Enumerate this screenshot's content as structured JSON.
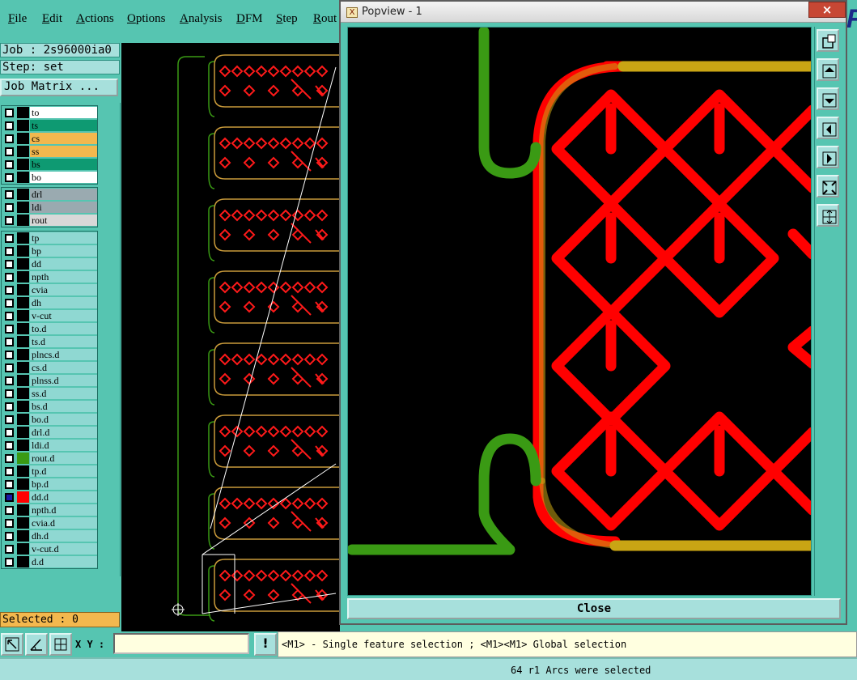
{
  "menubar": {
    "items": [
      {
        "label": "File",
        "mnemonic": "F",
        "rest": "ile"
      },
      {
        "label": "Edit",
        "mnemonic": "E",
        "rest": "dit"
      },
      {
        "label": "Actions",
        "mnemonic": "A",
        "rest": "ctions"
      },
      {
        "label": "Options",
        "mnemonic": "O",
        "rest": "ptions"
      },
      {
        "label": "Analysis",
        "mnemonic": "A",
        "rest": "nalysis"
      },
      {
        "label": "DFM",
        "mnemonic": "D",
        "rest": "FM"
      },
      {
        "label": "Step",
        "mnemonic": "S",
        "rest": "tep"
      },
      {
        "label": "Rout",
        "mnemonic": "R",
        "rest": "out"
      }
    ],
    "corner_text": "F"
  },
  "left_panel": {
    "job_label": "Job : 2s96000ia0",
    "step_label": "Step: set",
    "job_matrix_button": "Job Matrix ...",
    "selected_label": "Selected : 0",
    "layer_groups": [
      [
        {
          "name": "to",
          "color": "#ffffff",
          "swatch": "#000000",
          "selected": false
        },
        {
          "name": "ts",
          "color": "#0e9a72",
          "swatch": "#000000",
          "selected": false
        },
        {
          "name": "cs",
          "color": "#f3b84e",
          "swatch": "#000000",
          "selected": false
        },
        {
          "name": "ss",
          "color": "#f3b84e",
          "swatch": "#000000",
          "selected": false
        },
        {
          "name": "bs",
          "color": "#0e9a72",
          "swatch": "#000000",
          "selected": false
        },
        {
          "name": "bo",
          "color": "#ffffff",
          "swatch": "#000000",
          "selected": false
        }
      ],
      [
        {
          "name": "drl",
          "color": "#9aaab0",
          "swatch": "#000000",
          "selected": false
        },
        {
          "name": "ldi",
          "color": "#9aaab0",
          "swatch": "#000000",
          "selected": false
        },
        {
          "name": "rout",
          "color": "#d8d8d8",
          "swatch": "#000000",
          "selected": false
        }
      ],
      [
        {
          "name": "tp",
          "color": "#8fd8d2",
          "swatch": "#000000",
          "selected": false
        },
        {
          "name": "bp",
          "color": "#8fd8d2",
          "swatch": "#000000",
          "selected": false
        },
        {
          "name": "dd",
          "color": "#8fd8d2",
          "swatch": "#000000",
          "selected": false
        },
        {
          "name": "npth",
          "color": "#8fd8d2",
          "swatch": "#000000",
          "selected": false
        },
        {
          "name": "cvia",
          "color": "#8fd8d2",
          "swatch": "#000000",
          "selected": false
        },
        {
          "name": "dh",
          "color": "#8fd8d2",
          "swatch": "#000000",
          "selected": false
        },
        {
          "name": "v-cut",
          "color": "#8fd8d2",
          "swatch": "#000000",
          "selected": false
        },
        {
          "name": "to.d",
          "color": "#8fd8d2",
          "swatch": "#000000",
          "selected": false
        },
        {
          "name": "ts.d",
          "color": "#8fd8d2",
          "swatch": "#000000",
          "selected": false
        },
        {
          "name": "plncs.d",
          "color": "#8fd8d2",
          "swatch": "#000000",
          "selected": false
        },
        {
          "name": "cs.d",
          "color": "#8fd8d2",
          "swatch": "#000000",
          "selected": false
        },
        {
          "name": "plnss.d",
          "color": "#8fd8d2",
          "swatch": "#000000",
          "selected": false
        },
        {
          "name": "ss.d",
          "color": "#8fd8d2",
          "swatch": "#000000",
          "selected": false
        },
        {
          "name": "bs.d",
          "color": "#8fd8d2",
          "swatch": "#000000",
          "selected": false
        },
        {
          "name": "bo.d",
          "color": "#8fd8d2",
          "swatch": "#000000",
          "selected": false
        },
        {
          "name": "drl.d",
          "color": "#8fd8d2",
          "swatch": "#000000",
          "selected": false
        },
        {
          "name": "ldi.d",
          "color": "#8fd8d2",
          "swatch": "#000000",
          "selected": false
        },
        {
          "name": "rout.d",
          "color": "#8fd8d2",
          "swatch": "#3a9a14",
          "selected": false
        },
        {
          "name": "tp.d",
          "color": "#8fd8d2",
          "swatch": "#000000",
          "selected": false
        },
        {
          "name": "bp.d",
          "color": "#8fd8d2",
          "swatch": "#000000",
          "selected": false
        },
        {
          "name": "dd.d",
          "color": "#8fd8d2",
          "swatch": "#ff0000",
          "selected": true
        },
        {
          "name": "npth.d",
          "color": "#8fd8d2",
          "swatch": "#000000",
          "selected": false
        },
        {
          "name": "cvia.d",
          "color": "#8fd8d2",
          "swatch": "#000000",
          "selected": false
        },
        {
          "name": "dh.d",
          "color": "#8fd8d2",
          "swatch": "#000000",
          "selected": false
        },
        {
          "name": "v-cut.d",
          "color": "#8fd8d2",
          "swatch": "#000000",
          "selected": false
        },
        {
          "name": "d.d",
          "color": "#8fd8d2",
          "swatch": "#000000",
          "selected": false
        }
      ]
    ]
  },
  "popview": {
    "title": "Popview - 1",
    "title_icon": "X",
    "close_x": "×",
    "close_button": "Close",
    "tools": [
      "zoom-window-icon",
      "pan-up-icon",
      "pan-down-icon",
      "pan-left-icon",
      "pan-right-icon",
      "zoom-fit-icon",
      "zoom-center-icon"
    ]
  },
  "bottom_bar": {
    "xy_label": "X Y :",
    "xy_value": "",
    "info_button": "!",
    "hint": "<M1> - Single feature selection ; <M1><M1> Global selection"
  },
  "status": {
    "text": "64 r1 Arcs were selected"
  },
  "colors": {
    "background": "#56c5b1",
    "panel_light": "#a7e0dc",
    "trace_red": "#ff0000",
    "trace_green": "#3a9a14",
    "trace_gold": "#c9a514"
  }
}
